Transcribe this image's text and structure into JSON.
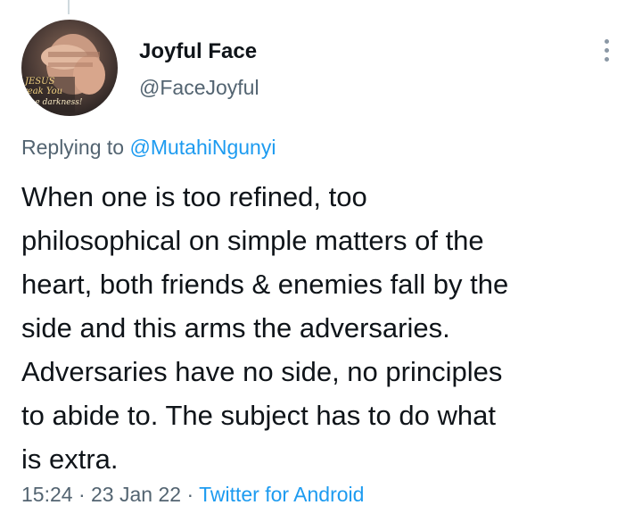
{
  "tweet": {
    "author": {
      "display_name": "Joyful Face",
      "handle": "@FaceJoyful",
      "avatar_text": [
        "JESUS",
        "reak You",
        "the darkness!"
      ]
    },
    "more_icon": "more-vertical-icon",
    "replying_prefix": "Replying to",
    "replying_to": "@MutahiNgunyi",
    "text": "When one is too refined, too\nphilosophical on simple matters of the\nheart, both friends & enemies fall by the\nside and this arms the adversaries.\nAdversaries have no side, no principles\nto abide to. The subject has to do what\nis extra.",
    "time": "15:24",
    "separator": "·",
    "date": "23 Jan 22",
    "source": "Twitter for Android"
  },
  "colors": {
    "text_primary": "#0f1419",
    "text_secondary": "#536471",
    "link": "#1d9bf0",
    "thread_line": "#cfd9de"
  }
}
